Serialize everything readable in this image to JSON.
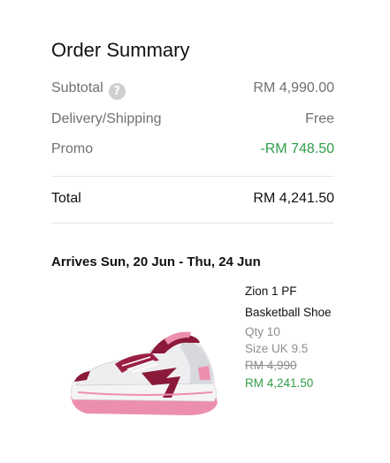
{
  "summary": {
    "title": "Order Summary",
    "subtotal_label": "Subtotal",
    "subtotal_help_icon": "?",
    "subtotal_value": "RM 4,990.00",
    "delivery_label": "Delivery/Shipping",
    "delivery_value": "Free",
    "promo_label": "Promo",
    "promo_value": "-RM 748.50",
    "total_label": "Total",
    "total_value": "RM 4,241.50"
  },
  "delivery": {
    "arrives": "Arrives Sun, 20 Jun - Thu, 24 Jun"
  },
  "product": {
    "image_icon": "basketball-shoe-image",
    "name": "Zion 1 PF Basketball Shoe",
    "qty": "Qty 10",
    "size": "Size UK 9.5",
    "original_price": "RM 4,990",
    "sale_price": "RM 4,241.50"
  },
  "colors": {
    "promo_green": "#2e9e49",
    "muted_text": "#707072",
    "shoe_maroon": "#8b1a3a",
    "shoe_pink": "#e88aa8"
  }
}
